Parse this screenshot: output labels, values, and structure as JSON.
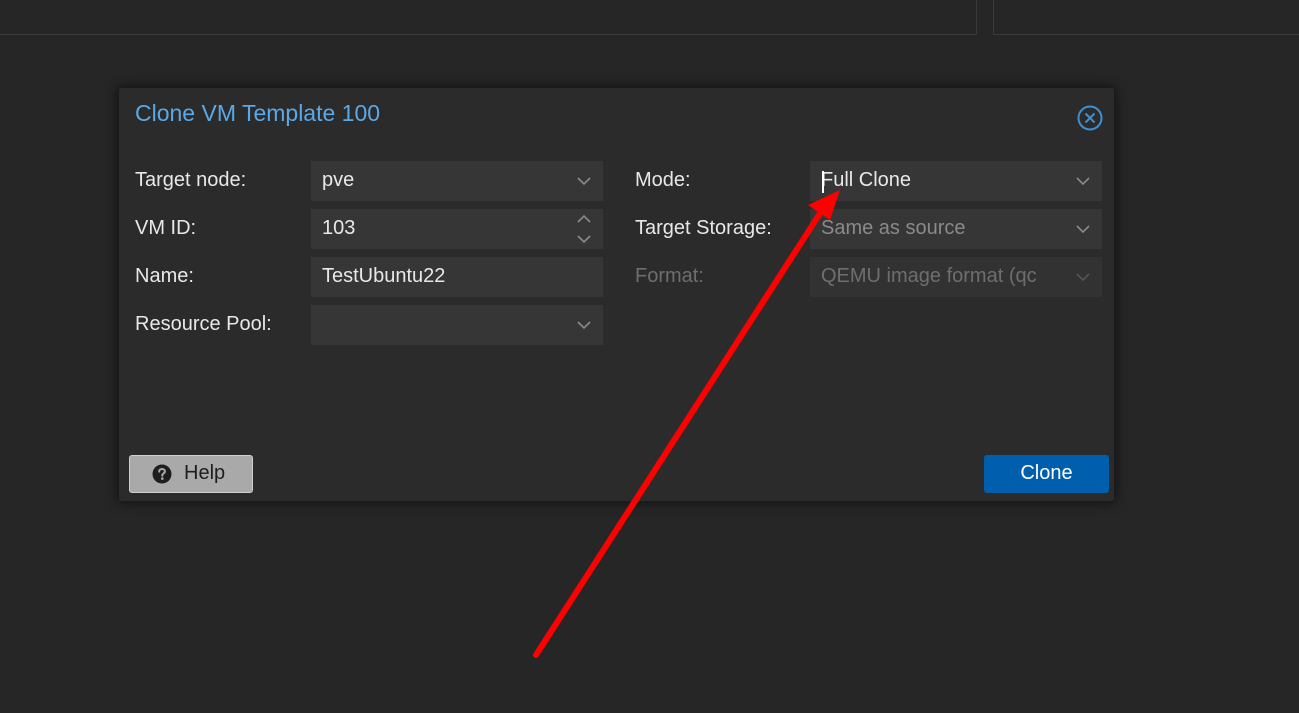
{
  "dialog": {
    "title": "Clone VM Template 100",
    "close_icon": "close-circle-icon",
    "accent_color": "#5aa9e6"
  },
  "left_fields": {
    "target_node": {
      "label": "Target node:",
      "value": "pve"
    },
    "vm_id": {
      "label": "VM ID:",
      "value": "103"
    },
    "name": {
      "label": "Name:",
      "value": "TestUbuntu22"
    },
    "resource_pool": {
      "label": "Resource Pool:",
      "value": ""
    }
  },
  "right_fields": {
    "mode": {
      "label": "Mode:",
      "value": "Full Clone"
    },
    "target_storage": {
      "label": "Target Storage:",
      "value": "Same as source"
    },
    "format": {
      "label": "Format:",
      "value": "QEMU image format (qc"
    }
  },
  "buttons": {
    "help_label": "Help",
    "help_icon": "question-circle-icon",
    "clone_label": "Clone",
    "clone_color": "#005fad"
  },
  "annotation": {
    "type": "red-arrow",
    "color": "#ff0000",
    "points_to": "mode-select"
  }
}
